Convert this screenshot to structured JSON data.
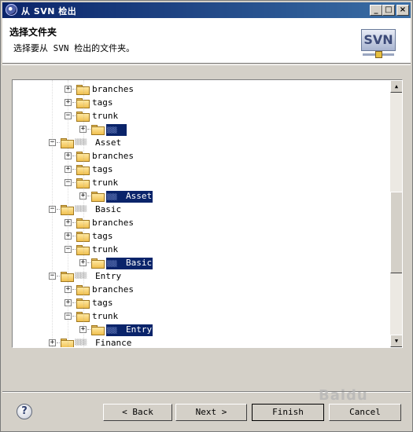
{
  "window": {
    "title": "从 SVN 检出",
    "controls": {
      "minimize": "_",
      "maximize": "□",
      "close": "×"
    }
  },
  "banner": {
    "title": "选择文件夹",
    "description": "选择要从 SVN 检出的文件夹。",
    "logo_text": "SVN"
  },
  "tree": {
    "rows": [
      {
        "label": "branches",
        "toggle": "+",
        "level": 2,
        "selected": false
      },
      {
        "label": "tags",
        "toggle": "+",
        "level": 2,
        "selected": false
      },
      {
        "label": "trunk",
        "toggle": "−",
        "level": 2,
        "selected": false
      },
      {
        "label": "",
        "toggle": "+",
        "level": 3,
        "selected": true
      },
      {
        "label": "Asset",
        "toggle": "−",
        "level": 1,
        "selected": false,
        "repo": true
      },
      {
        "label": "branches",
        "toggle": "+",
        "level": 2,
        "selected": false
      },
      {
        "label": "tags",
        "toggle": "+",
        "level": 2,
        "selected": false
      },
      {
        "label": "trunk",
        "toggle": "−",
        "level": 2,
        "selected": false
      },
      {
        "label": "Asset",
        "toggle": "+",
        "level": 3,
        "selected": true
      },
      {
        "label": "Basic",
        "toggle": "−",
        "level": 1,
        "selected": false,
        "repo": true
      },
      {
        "label": "branches",
        "toggle": "+",
        "level": 2,
        "selected": false
      },
      {
        "label": "tags",
        "toggle": "+",
        "level": 2,
        "selected": false
      },
      {
        "label": "trunk",
        "toggle": "−",
        "level": 2,
        "selected": false
      },
      {
        "label": "Basic",
        "toggle": "+",
        "level": 3,
        "selected": true
      },
      {
        "label": "Entry",
        "toggle": "−",
        "level": 1,
        "selected": false,
        "repo": true
      },
      {
        "label": "branches",
        "toggle": "+",
        "level": 2,
        "selected": false
      },
      {
        "label": "tags",
        "toggle": "+",
        "level": 2,
        "selected": false
      },
      {
        "label": "trunk",
        "toggle": "−",
        "level": 2,
        "selected": false
      },
      {
        "label": "Entry",
        "toggle": "+",
        "level": 3,
        "selected": true
      },
      {
        "label": "Finance",
        "toggle": "+",
        "level": 1,
        "selected": false,
        "repo": true
      }
    ]
  },
  "scrollbar": {
    "up": "▲",
    "down": "▼"
  },
  "buttons": {
    "help": "?",
    "back": "< Back",
    "next": "Next >",
    "finish": "Finish",
    "cancel": "Cancel"
  },
  "watermark": "Baidu"
}
